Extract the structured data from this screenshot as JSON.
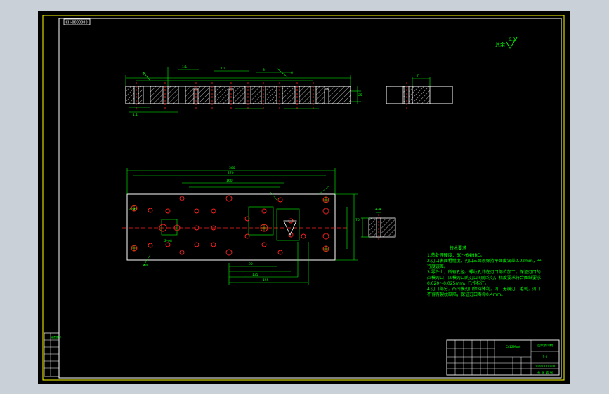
{
  "drawing": {
    "drawing_number_box": "CH-0000000",
    "roughness_note": "其余",
    "roughness_value": "6.3",
    "section_label": "A-A",
    "view_label": "B",
    "tech_req": {
      "title": "技术要求",
      "lines": [
        "1.热处理硬度：60～64HRC。",
        "2.刃口表面粗糙度，刃口三面须保持平面度误差0.02mm，平",
        "  行度误差。",
        "3.零件上，所有孔径、螺纹孔均在刃口部位加工，保证刃口的",
        "  凸模刃口，凹模刃口的刃口间隙均匀，精度要求符合图纸要求",
        "  0.020～0.025mm，已作标注。",
        "4.刃口部分，凸凹模刃口保持锋利，刃口无崩刃、毛刺，刃口",
        "  不得有裂纹缺陷，保证刃口寿命0.4mm。"
      ]
    },
    "title_block": {
      "part_name": "连续模凹模",
      "material": "Cr12MoV",
      "scale": "1:1",
      "drawing_code": "00000000-01",
      "sheet": "共 张 第 张"
    },
    "side_stamp": "装配图号"
  }
}
